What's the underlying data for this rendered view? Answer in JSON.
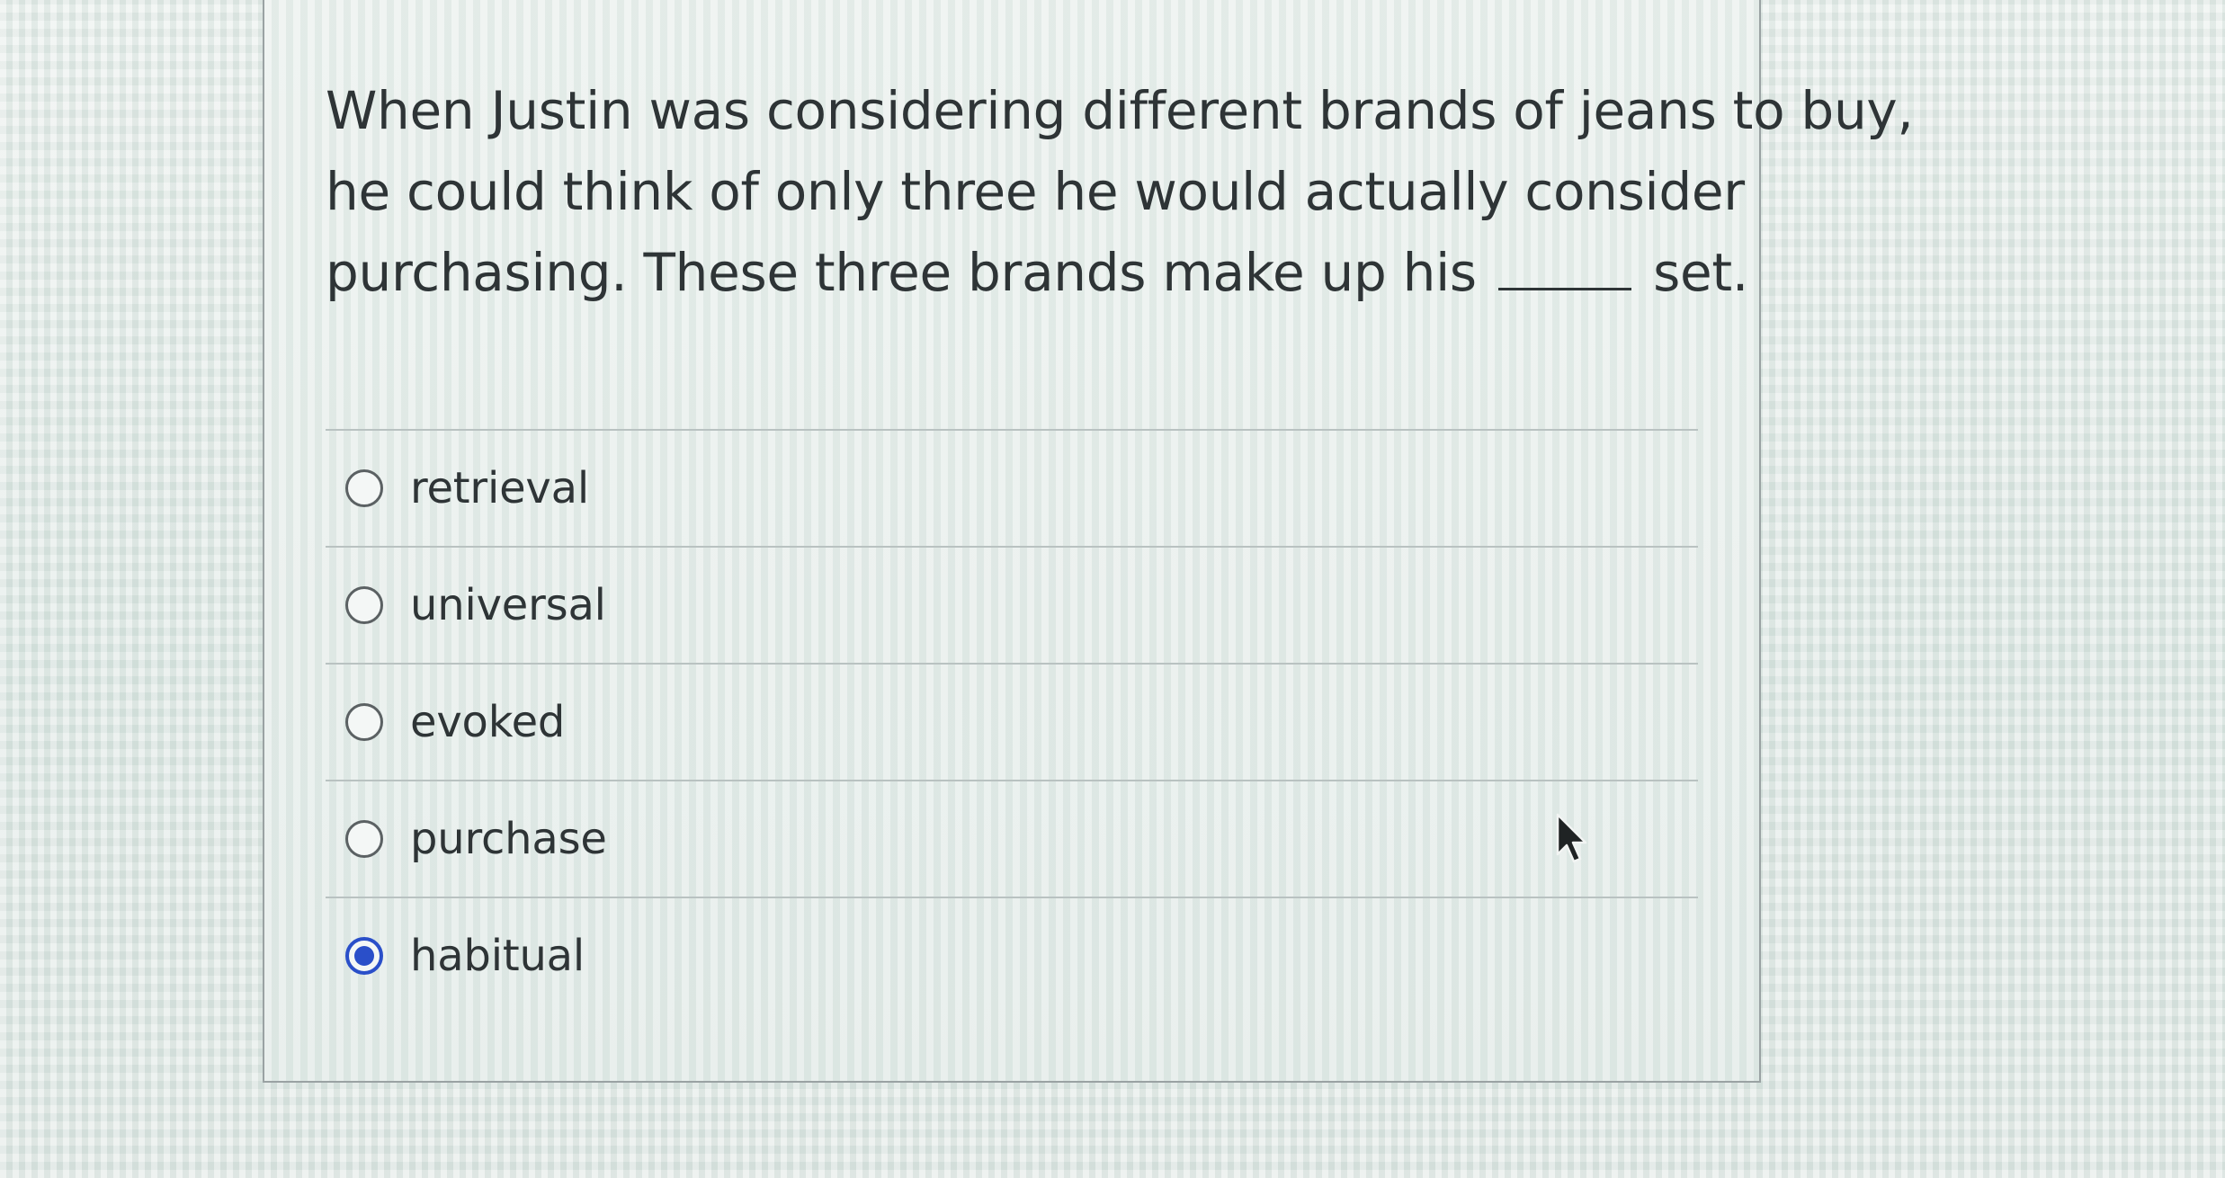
{
  "question": {
    "line1": "When Justin was considering different brands of jeans to buy,",
    "line2": "he could think of only three he would actually consider",
    "line3_before": "purchasing. These three brands make up his",
    "line3_after": "set."
  },
  "options": [
    {
      "label": "retrieval",
      "selected": false
    },
    {
      "label": "universal",
      "selected": false
    },
    {
      "label": "evoked",
      "selected": false
    },
    {
      "label": "purchase",
      "selected": false
    },
    {
      "label": "habitual",
      "selected": true
    }
  ],
  "colors": {
    "accent": "#2a4fc9",
    "text": "#2e3436",
    "border": "#9aa2a3"
  },
  "icons": {
    "cursor": "mouse-pointer-icon"
  }
}
